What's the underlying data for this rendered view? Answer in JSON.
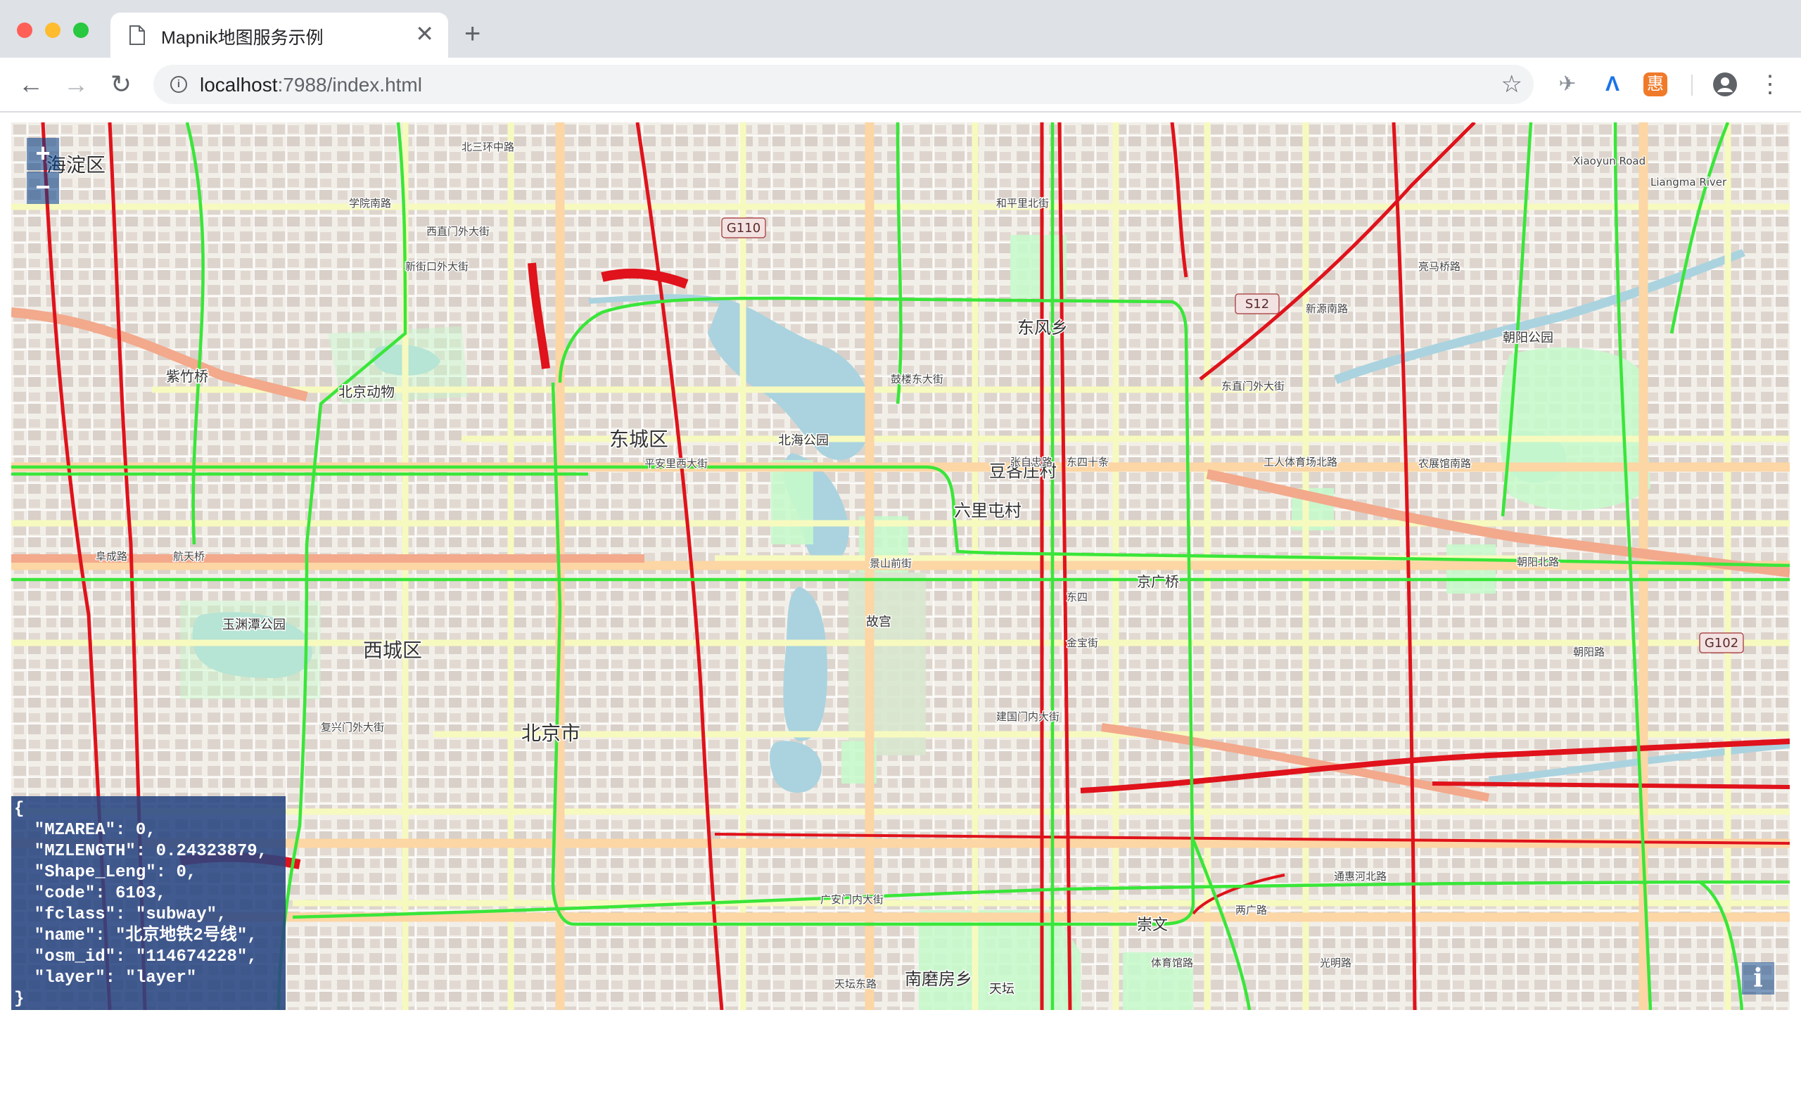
{
  "browser": {
    "tab_title": "Mapnik地图服务示例",
    "tab_close": "✕",
    "new_tab": "+",
    "url_host": "localhost",
    "url_rest": ":7988/index.html",
    "back": "←",
    "forward": "→",
    "reload": "↻",
    "bookmark": "☆",
    "menu": "⋮",
    "extensions": [
      "✈",
      "Λ",
      "惠"
    ],
    "colors": {
      "close": "#ff5f57",
      "minimize": "#febc2e",
      "maximize": "#28c840",
      "tab_bar": "#dee1e6"
    }
  },
  "map": {
    "zoom_in": "+",
    "zoom_out": "−",
    "attribution": "i",
    "districts": [
      {
        "name": "海淀区"
      },
      {
        "name": "东城区"
      },
      {
        "name": "西城区"
      },
      {
        "name": "北京市"
      },
      {
        "name": "东风乡"
      },
      {
        "name": "豆各庄村"
      },
      {
        "name": "六里屯村"
      },
      {
        "name": "南磨房乡"
      },
      {
        "name": "崇文"
      },
      {
        "name": "京广桥"
      },
      {
        "name": "紫竹桥"
      },
      {
        "name": "北京动物"
      },
      {
        "name": "北海公园"
      },
      {
        "name": "故宫"
      },
      {
        "name": "玉渊潭公园"
      },
      {
        "name": "朝阳公园"
      },
      {
        "name": "天坛"
      }
    ],
    "shields": [
      "G110",
      "S12",
      "G102"
    ],
    "road_labels": [
      "学院南路",
      "新街口外大街",
      "鼓楼东大街",
      "张自忠路",
      "东四十条",
      "工人体育场北路",
      "朝阳北路",
      "建国门内大街",
      "复兴门外大街",
      "广安门内大街",
      "两广路",
      "平安里西大街",
      "景山前街",
      "金宝街",
      "通惠河北路",
      "北三环中路",
      "朝阳路",
      "阜成路",
      "西直门外大街",
      "航天桥",
      "和平里北街",
      "新源南路",
      "亮马桥路",
      "Xiaoyun Road",
      "Liangma River",
      "东直门外大街",
      "农展馆南路",
      "光明路",
      "体育馆路",
      "东四",
      "天坛东路"
    ],
    "colors": {
      "land": "#f2efe9",
      "water": "#aad3df",
      "park": "#c8facc",
      "subway": "#39e639",
      "motorway": "#e0121b",
      "primary": "#fcd6a4",
      "secondary": "#f7fabf",
      "building": "#d9d0c9"
    }
  },
  "feature_info": {
    "open": "{",
    "lines": [
      "  \"MZAREA\": 0,",
      "  \"MZLENGTH\": 0.24323879,",
      "  \"Shape_Leng\": 0,",
      "  \"code\": 6103,",
      "  \"fclass\": \"subway\",",
      "  \"name\": \"北京地铁2号线\",",
      "  \"osm_id\": \"114674228\",",
      "  \"layer\": \"layer\""
    ],
    "close": "}"
  }
}
